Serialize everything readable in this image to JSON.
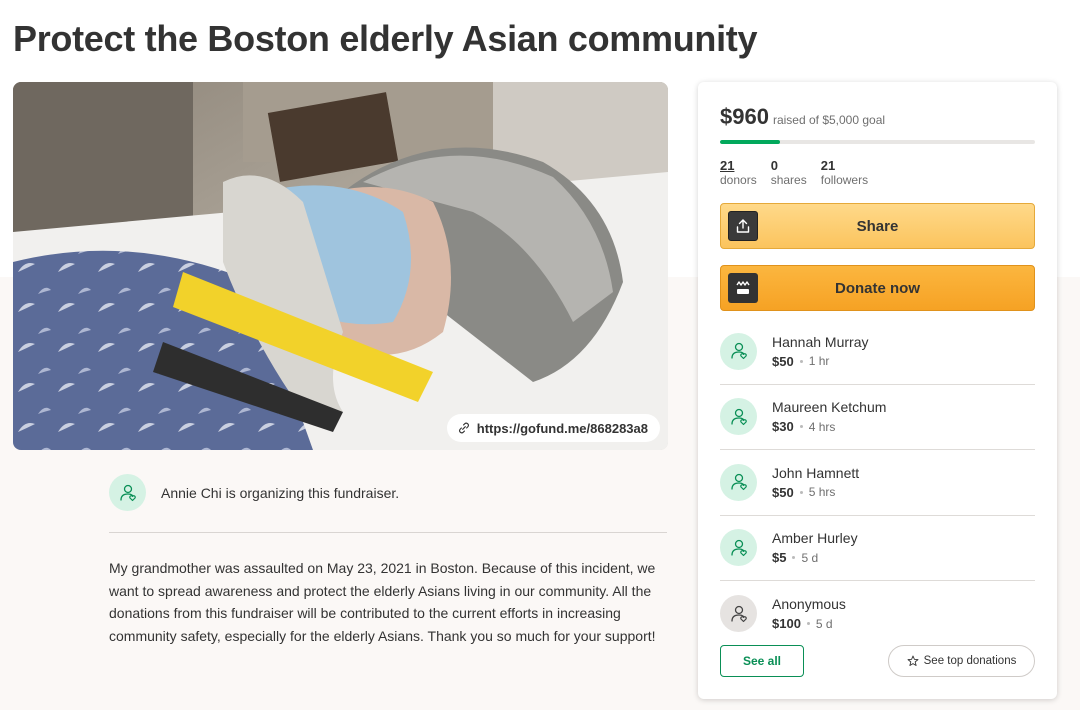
{
  "page": {
    "title": "Protect the Boston elderly Asian community"
  },
  "hero": {
    "short_link": "https://gofund.me/868283a8",
    "link_icon": "link-icon"
  },
  "organizer": {
    "text": "Annie Chi is organizing this fundraiser.",
    "icon": "user-heart-icon"
  },
  "story": {
    "text": "My grandmother was assaulted on May 23, 2021 in Boston. Because of this incident, we want to spread awareness and protect the elderly Asians living in our community. All the donations from this fundraiser will be contributed to the current efforts in increasing community safety, especially for the elderly Asians. Thank you so much for your support!"
  },
  "sidebar": {
    "raised": "$960",
    "goal_text": "raised of $5,000 goal",
    "progress_fraction": 0.192,
    "stats": [
      {
        "number": "21",
        "label": "donors"
      },
      {
        "number": "0",
        "label": "shares"
      },
      {
        "number": "21",
        "label": "followers"
      }
    ],
    "share_label": "Share",
    "share_icon": "upload-icon",
    "donate_label": "Donate now",
    "donate_icon": "gofundme-logo-icon",
    "donations": [
      {
        "name": "Hannah Murray",
        "amount": "$50",
        "time": "1 hr",
        "anonymous": false
      },
      {
        "name": "Maureen Ketchum",
        "amount": "$30",
        "time": "4 hrs",
        "anonymous": false
      },
      {
        "name": "John Hamnett",
        "amount": "$50",
        "time": "5 hrs",
        "anonymous": false
      },
      {
        "name": "Amber Hurley",
        "amount": "$5",
        "time": "5 d",
        "anonymous": false
      },
      {
        "name": "Anonymous",
        "amount": "$100",
        "time": "5 d",
        "anonymous": true
      }
    ],
    "see_all_label": "See all",
    "see_top_label": "See top donations",
    "see_top_icon": "star-icon"
  },
  "colors": {
    "accent_green": "#02a95c",
    "share_yellow": "#fbc45e",
    "donate_orange": "#f6a224"
  }
}
